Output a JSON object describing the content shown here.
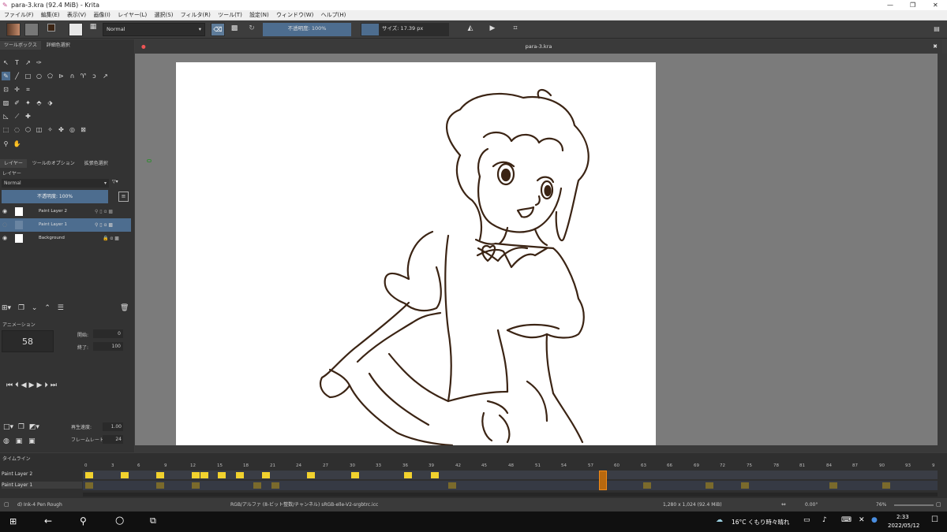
{
  "window": {
    "title": "para-3.kra (92.4 MiB)  - Krita"
  },
  "menu": [
    "ファイル(F)",
    "編集(E)",
    "表示(V)",
    "画像(I)",
    "レイヤー(L)",
    "選択(S)",
    "フィルタ(R)",
    "ツール(T)",
    "設定(N)",
    "ウィンドウ(W)",
    "ヘルプ(H)"
  ],
  "toolbar": {
    "blend_mode": "Normal",
    "opacity_label": "不透明度: 100%",
    "size_label": "サイズ: 17.39 px"
  },
  "left_tabs": {
    "toolbox": "ツールボックス",
    "advanced_color": "詳細色選択"
  },
  "docker_tabs": [
    "レイヤー",
    "ツールのオプション",
    "拡張色選択"
  ],
  "layers": {
    "title": "レイヤー",
    "blend": "Normal",
    "opacity": "不透明度: 100%",
    "items": [
      {
        "name": "Paint Layer 2"
      },
      {
        "name": "Paint Layer 1"
      },
      {
        "name": "Background"
      }
    ]
  },
  "animation": {
    "title": "アニメーション",
    "current_frame": "58",
    "start_label": "開始:",
    "start_value": "0",
    "end_label": "終了:",
    "end_value": "100",
    "speed_label": "再生速度:",
    "speed_value": "1.00",
    "fps_label": "フレームレート:",
    "fps_value": "24"
  },
  "document": {
    "tab": "para-3.kra"
  },
  "timeline": {
    "title": "タイムライン",
    "ticks": [
      "0",
      "3",
      "6",
      "9",
      "12",
      "15",
      "18",
      "21",
      "24",
      "27",
      "30",
      "33",
      "36",
      "39",
      "42",
      "45",
      "48",
      "51",
      "54",
      "57",
      "60",
      "63",
      "66",
      "69",
      "72",
      "75",
      "78",
      "81",
      "84",
      "87",
      "90",
      "93",
      "9"
    ],
    "rows": [
      "Paint Layer 2",
      "Paint Layer 1"
    ]
  },
  "status": {
    "brush": "d) Ink-4 Pen Rough",
    "color_space": "RGB/アルファ (8-ビット整数/チャンネル)  sRGB-elle-V2-srgbtrc.icc",
    "dimensions": "1,280 x 1,024 (92.4 MiB)",
    "rotation": "0.00°",
    "zoom": "76%"
  },
  "taskbar": {
    "weather": "16°C くもり時々晴れ",
    "time": "2:33",
    "date": "2022/05/12"
  },
  "colors": {
    "accent": "#4d6d8f",
    "keyframe": "#f2d22e",
    "line_art": "#3b2414"
  }
}
